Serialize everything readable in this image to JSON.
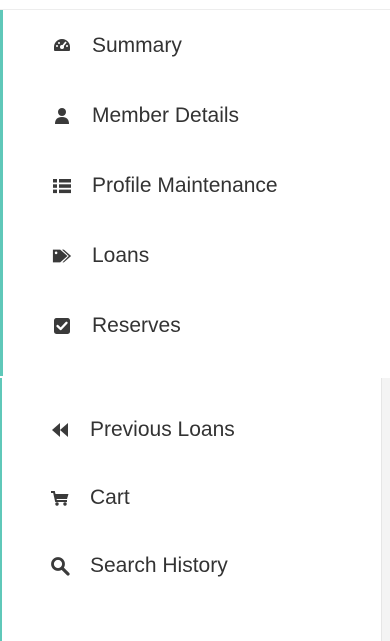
{
  "menu": {
    "items": [
      {
        "label": "Summary",
        "icon": "tachometer-icon"
      },
      {
        "label": "Member Details",
        "icon": "user-icon"
      },
      {
        "label": "Profile Maintenance",
        "icon": "list-icon"
      },
      {
        "label": "Loans",
        "icon": "tags-icon"
      },
      {
        "label": "Reserves",
        "icon": "check-square-icon"
      }
    ]
  },
  "secondary_menu": {
    "items": [
      {
        "label": "Previous Loans",
        "icon": "backward-icon"
      },
      {
        "label": "Cart",
        "icon": "cart-icon"
      },
      {
        "label": "Search History",
        "icon": "search-icon"
      }
    ]
  },
  "colors": {
    "accent": "#5fc8b9",
    "text": "#333333",
    "icon": "#3a3a3a"
  }
}
